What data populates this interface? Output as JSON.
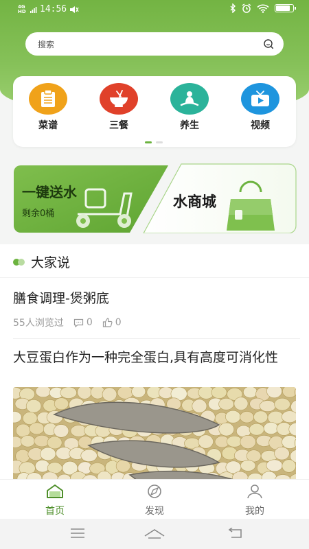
{
  "status_bar": {
    "network": "4G HD",
    "time": "14:56",
    "battery_level": 0.85
  },
  "search": {
    "placeholder": "搜索",
    "icon": "search-icon"
  },
  "categories": [
    {
      "label": "菜谱",
      "icon": "clipboard-icon",
      "color": "#f0a21a"
    },
    {
      "label": "三餐",
      "icon": "bowl-icon",
      "color": "#e0412a"
    },
    {
      "label": "养生",
      "icon": "meditation-icon",
      "color": "#2bb39a"
    },
    {
      "label": "视频",
      "icon": "tv-icon",
      "color": "#1e95de"
    }
  ],
  "carousel": {
    "pages": 2,
    "active": 0
  },
  "banners": {
    "water_delivery": {
      "title": "一键送水",
      "subtitle": "剩余0桶"
    },
    "water_shop": {
      "title": "水商城"
    }
  },
  "section": {
    "title": "大家说"
  },
  "articles": [
    {
      "title": "膳食调理-煲粥底",
      "views": "55人浏览过",
      "comments": "0",
      "likes": "0"
    },
    {
      "title": "大豆蛋白作为一种完全蛋白,具有高度可消化性"
    }
  ],
  "tabs": [
    {
      "label": "首页",
      "icon": "home-icon",
      "active": true
    },
    {
      "label": "发现",
      "icon": "discover-icon",
      "active": false
    },
    {
      "label": "我的",
      "icon": "profile-icon",
      "active": false
    }
  ],
  "colors": {
    "brand_green": "#6cb33f",
    "active_tab": "#4e8f2a",
    "inactive_tab": "#888888"
  }
}
